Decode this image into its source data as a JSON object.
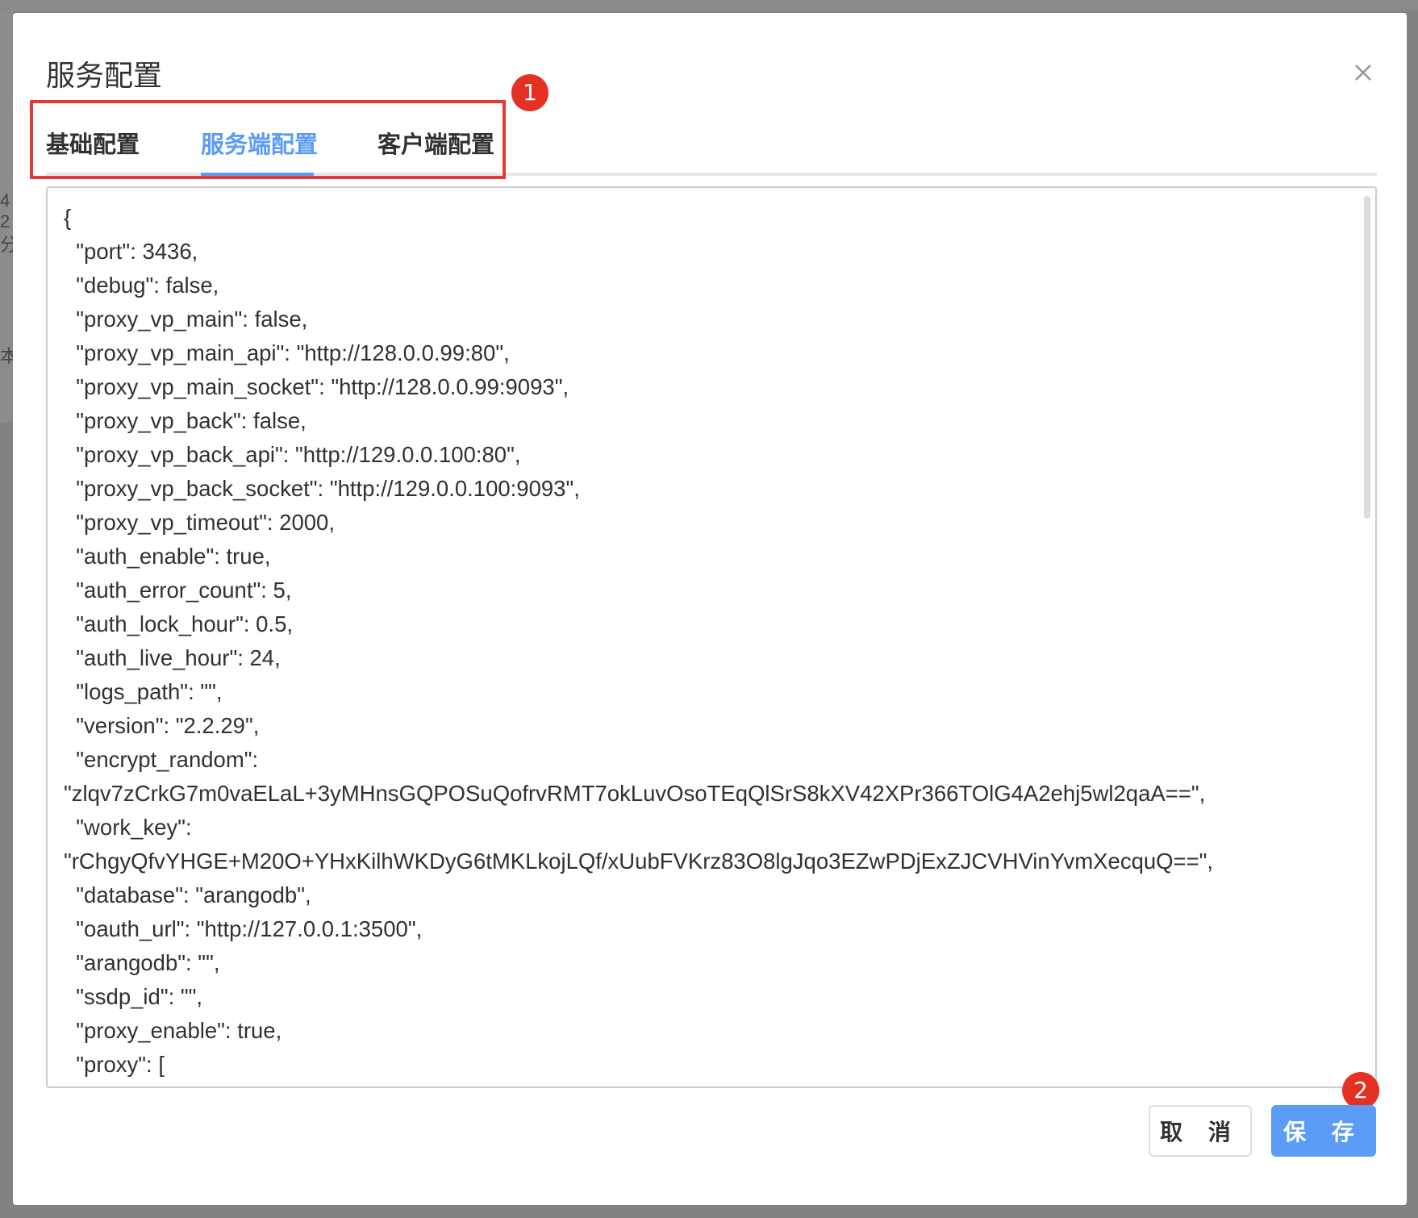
{
  "background": {
    "fragments": [
      "4 2",
      "分",
      "本"
    ]
  },
  "dialog": {
    "title": "服务配置",
    "close_icon": "close-icon"
  },
  "tabs": [
    {
      "label": "基础配置",
      "active": false
    },
    {
      "label": "服务端配置",
      "active": true
    },
    {
      "label": "客户端配置",
      "active": false
    }
  ],
  "annotations": {
    "badge_1": "1",
    "badge_2": "2"
  },
  "editor": {
    "content": "{\n  \"port\": 3436,\n  \"debug\": false,\n  \"proxy_vp_main\": false,\n  \"proxy_vp_main_api\": \"http://128.0.0.99:80\",\n  \"proxy_vp_main_socket\": \"http://128.0.0.99:9093\",\n  \"proxy_vp_back\": false,\n  \"proxy_vp_back_api\": \"http://129.0.0.100:80\",\n  \"proxy_vp_back_socket\": \"http://129.0.0.100:9093\",\n  \"proxy_vp_timeout\": 2000,\n  \"auth_enable\": true,\n  \"auth_error_count\": 5,\n  \"auth_lock_hour\": 0.5,\n  \"auth_live_hour\": 24,\n  \"logs_path\": \"\",\n  \"version\": \"2.2.29\",\n  \"encrypt_random\":\n\"zlqv7zCrkG7m0vaELaL+3yMHnsGQPOSuQofrvRMT7okLuvOsoTEqQlSrS8kXV42XPr366TOlG4A2ehj5wl2qaA==\",\n  \"work_key\":\n\"rChgyQfvYHGE+M20O+YHxKilhWKDyG6tMKLkojLQf/xUubFVKrz83O8lgJqo3EZwPDjExZJCVHVinYvmXecquQ==\",\n  \"database\": \"arangodb\",\n  \"oauth_url\": \"http://127.0.0.1:3500\",\n  \"arangodb\": \"\",\n  \"ssdp_id\": \"\",\n  \"proxy_enable\": true,\n  \"proxy\": [\n    {"
  },
  "footer": {
    "cancel_label": "取 消",
    "save_label": "保 存"
  },
  "colors": {
    "accent": "#5b9cf6",
    "annotation_red": "#e53024",
    "overlay": "#7f7f7f"
  }
}
